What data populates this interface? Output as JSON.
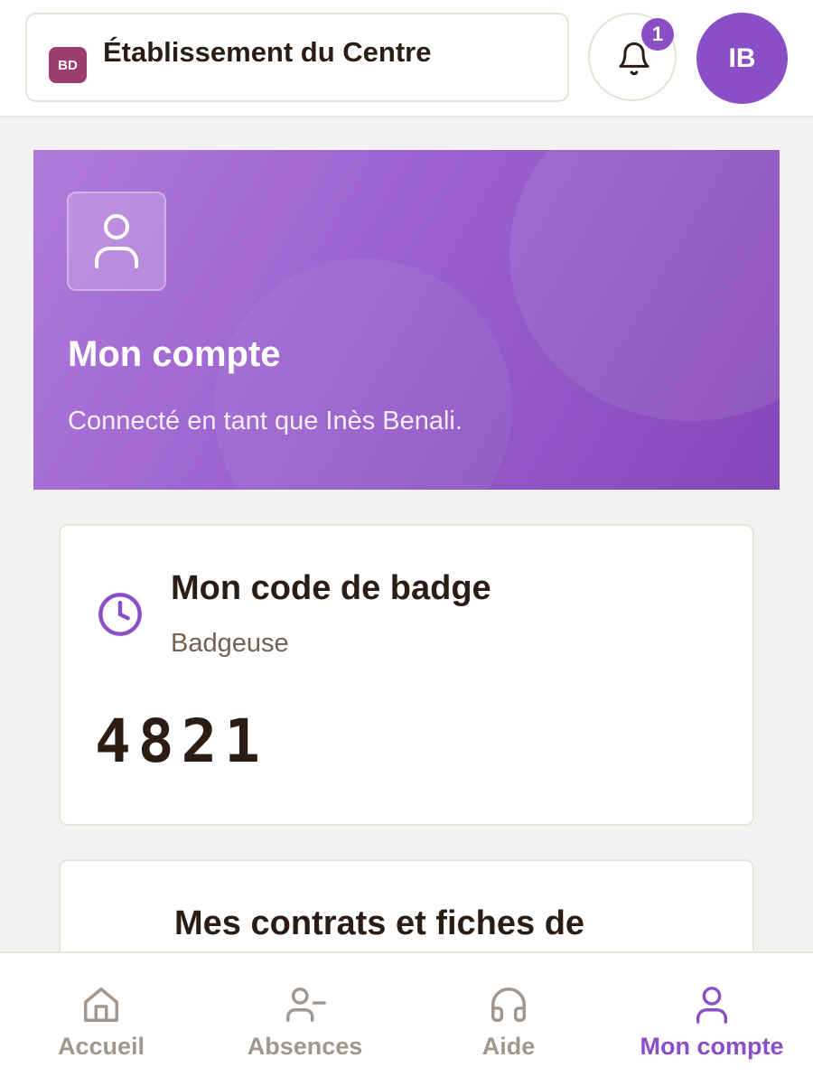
{
  "header": {
    "org_initials": "BD",
    "org_name": "Établissement du Centre",
    "notification_count": "1",
    "user_initials": "IB"
  },
  "banner": {
    "title": "Mon compte",
    "subtitle": "Connecté en tant que Inès Benali."
  },
  "badge_card": {
    "title": "Mon code de badge",
    "subtitle": "Badgeuse",
    "code": "4821"
  },
  "contracts_card": {
    "title": "Mes contrats et fiches de"
  },
  "nav": {
    "items": [
      {
        "label": "Accueil",
        "icon": "home-icon"
      },
      {
        "label": "Absences",
        "icon": "user-minus-icon"
      },
      {
        "label": "Aide",
        "icon": "headphones-icon"
      },
      {
        "label": "Mon compte",
        "icon": "user-icon",
        "active": true
      }
    ]
  },
  "colors": {
    "accent": "#8a4fc7",
    "org_badge": "#9b3d6e",
    "text": "#2b1d14",
    "muted": "#a3968a"
  }
}
